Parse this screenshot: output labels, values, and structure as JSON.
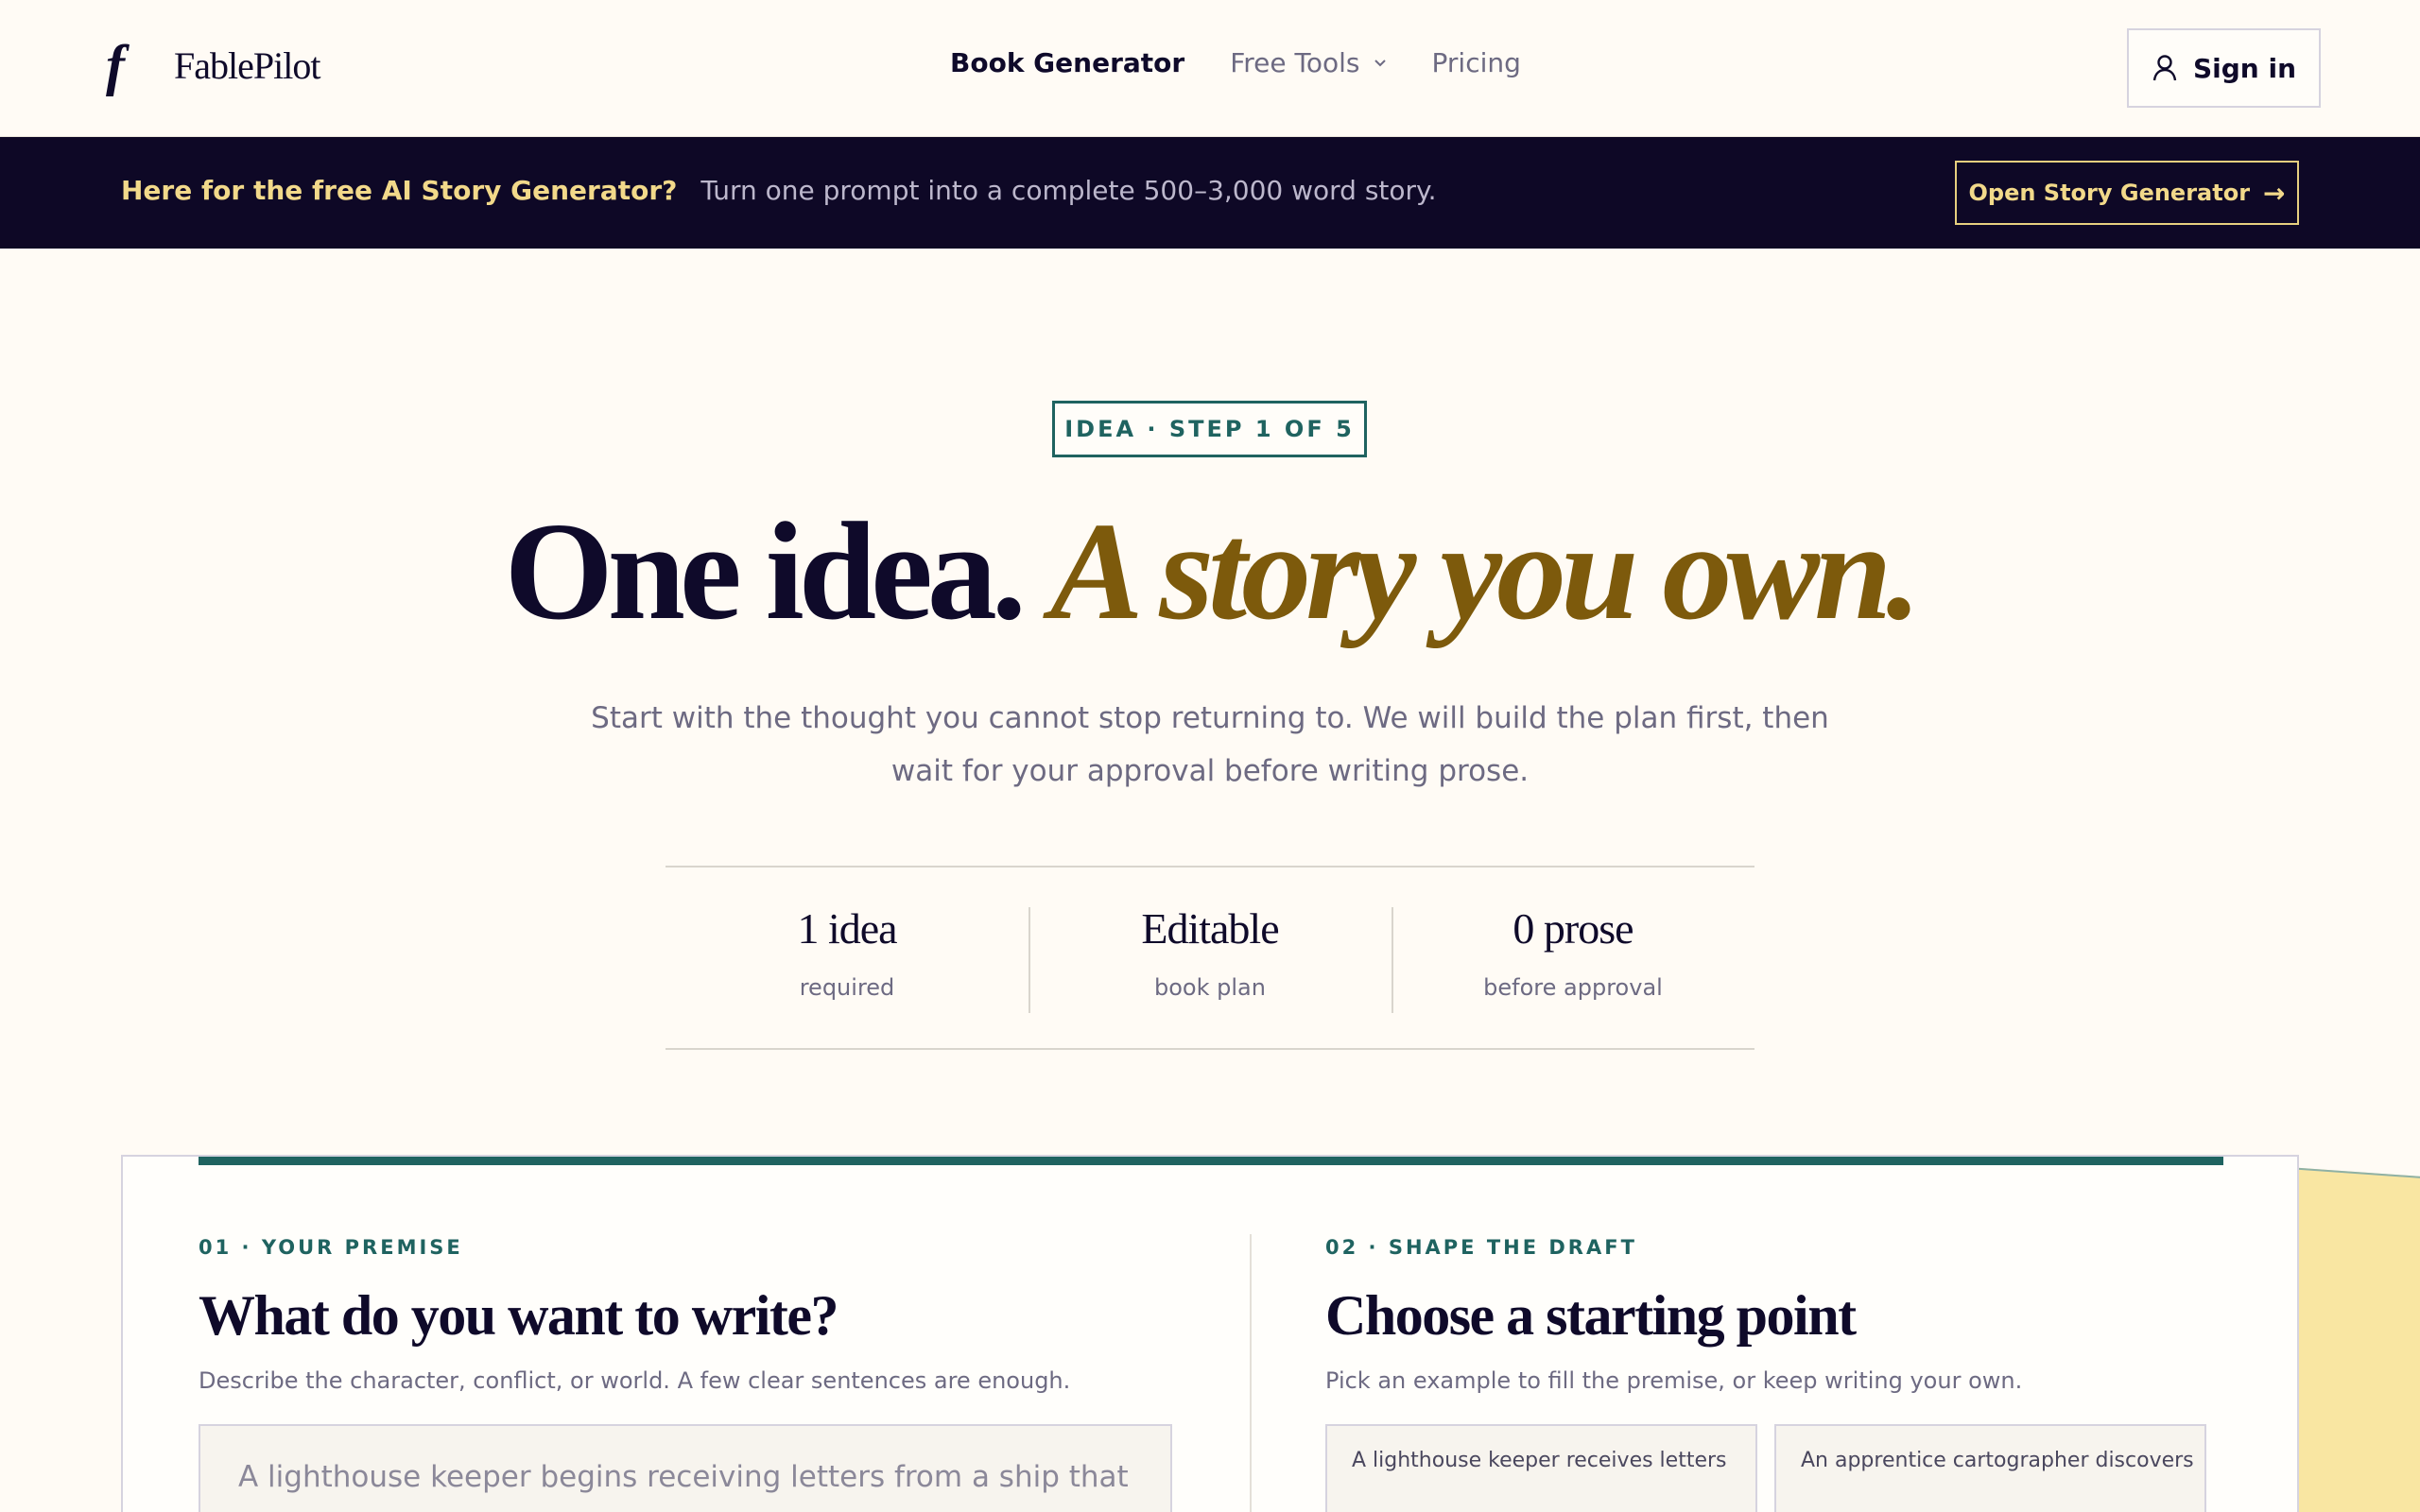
{
  "header": {
    "brand": "FablePilot",
    "logo_mark": "f",
    "nav": [
      {
        "label": "Book Generator"
      },
      {
        "label": "Free Tools"
      },
      {
        "label": "Pricing"
      }
    ],
    "signin_label": "Sign in"
  },
  "banner": {
    "headline": "Here for the free AI Story Generator?",
    "text": "Turn one prompt into a complete 500–3,000 word story.",
    "button_label": "Open Story Generator",
    "button_arrow": "→"
  },
  "hero": {
    "badge": "IDEA · STEP 1 OF 5",
    "title_main": "One idea.",
    "title_accent": "A story you own.",
    "subtitle": "Start with the thought you cannot stop returning to. We will build the plan first, then wait for your approval before writing prose."
  },
  "stats": [
    {
      "value": "1 idea",
      "label": "required"
    },
    {
      "value": "Editable",
      "label": "book plan"
    },
    {
      "value": "0 prose",
      "label": "before approval"
    }
  ],
  "premise": {
    "kicker": "01 · YOUR PREMISE",
    "title": "What do you want to write?",
    "description": "Describe the character, conflict, or world. A few clear sentences are enough.",
    "placeholder": "A lighthouse keeper begins receiving letters from a ship that"
  },
  "shape": {
    "kicker": "02 · SHAPE THE DRAFT",
    "title": "Choose a starting point",
    "description": "Pick an example to fill the premise, or keep writing your own.",
    "examples": [
      {
        "label": "A lighthouse keeper receives letters"
      },
      {
        "label": "An apprentice cartographer discovers"
      }
    ]
  },
  "colors": {
    "accent_teal": "#1f6360",
    "accent_gold": "#7d5a0c",
    "banner_bg": "#0e0826",
    "banner_highlight": "#f2d98a",
    "page_bg": "#fffbf5"
  }
}
